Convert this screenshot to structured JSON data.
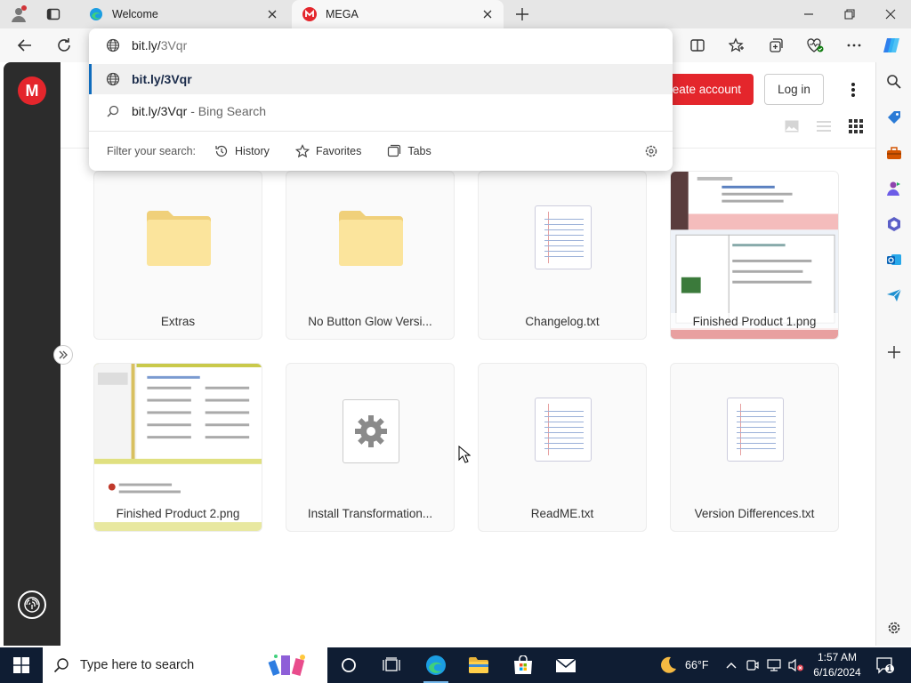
{
  "browser": {
    "tabs": [
      {
        "title": "Welcome",
        "favicon": "edge-icon",
        "active": false
      },
      {
        "title": "MEGA",
        "favicon": "mega-icon",
        "active": true
      }
    ],
    "address_text": "bit.ly/",
    "address_hint": "3Vqr"
  },
  "omnibox": {
    "suggestions": [
      {
        "text": "bit.ly/3Vqr",
        "suffix": "",
        "icon": "globe-icon"
      },
      {
        "text": "bit.ly/3Vqr",
        "suffix": "- Bing Search",
        "icon": "search-icon"
      }
    ],
    "filter_label": "Filter your search:",
    "filters": [
      "History",
      "Favorites",
      "Tabs"
    ]
  },
  "mega": {
    "create_account": "eate account",
    "login": "Log in",
    "files": [
      {
        "name": "Extras",
        "kind": "folder"
      },
      {
        "name": "No Button Glow Versi...",
        "kind": "folder"
      },
      {
        "name": "Changelog.txt",
        "kind": "text"
      },
      {
        "name": "Finished Product 1.png",
        "kind": "image"
      },
      {
        "name": "Finished Product 2.png",
        "kind": "image"
      },
      {
        "name": "Install Transformation...",
        "kind": "executable"
      },
      {
        "name": "ReadME.txt",
        "kind": "text"
      },
      {
        "name": "Version Differences.txt",
        "kind": "text"
      }
    ],
    "accent": "#e4262c"
  },
  "taskbar": {
    "search_placeholder": "Type here to search",
    "weather": "66°F",
    "time": "1:57 AM",
    "date": "6/16/2024",
    "notifications": "1"
  }
}
